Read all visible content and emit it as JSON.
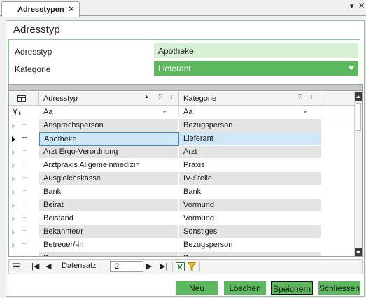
{
  "tab": {
    "label": "Adresstypen",
    "close": "✕"
  },
  "window_controls": {
    "pin": "▾",
    "close": "✕"
  },
  "panel": {
    "title": "Adresstyp"
  },
  "form": {
    "adresstyp_label": "Adresstyp",
    "adresstyp_value": "Apotheke",
    "kategorie_label": "Kategorie",
    "kategorie_value": "Lieferant"
  },
  "grid": {
    "columns": [
      {
        "label": "Adresstyp"
      },
      {
        "label": "Kategorie"
      }
    ],
    "filter_placeholder": "Aa",
    "rows": [
      {
        "adresstyp": "Ansprechsperson",
        "kategorie": "Bezugsperson"
      },
      {
        "adresstyp": "Apotheke",
        "kategorie": "Lieferant"
      },
      {
        "adresstyp": "Arzt Ergo-Verordnung",
        "kategorie": "Arzt"
      },
      {
        "adresstyp": "Arztpraxis Allgemeinmedizin",
        "kategorie": "Praxis"
      },
      {
        "adresstyp": "Ausgleichskasse",
        "kategorie": "IV-Stelle"
      },
      {
        "adresstyp": "Bank",
        "kategorie": "Bank"
      },
      {
        "adresstyp": "Beirat",
        "kategorie": "Vormund"
      },
      {
        "adresstyp": "Beistand",
        "kategorie": "Vormund"
      },
      {
        "adresstyp": "Bekannter/r",
        "kategorie": "Sonstiges"
      },
      {
        "adresstyp": "Betreuer/-in",
        "kategorie": "Bezugsperson"
      },
      {
        "adresstyp": "Bezugsperson",
        "kategorie": "Bezugsperson"
      }
    ],
    "selected_index": 1
  },
  "navigator": {
    "label": "Datensatz",
    "value": "2"
  },
  "buttons": {
    "new": "Neu",
    "delete": "Löschen",
    "save": "Speichern",
    "close": "Schliessen"
  },
  "colors": {
    "accent_green": "#5cb85c",
    "value_green": "#d8f0d5",
    "selection_blue": "#cfe8f8"
  }
}
